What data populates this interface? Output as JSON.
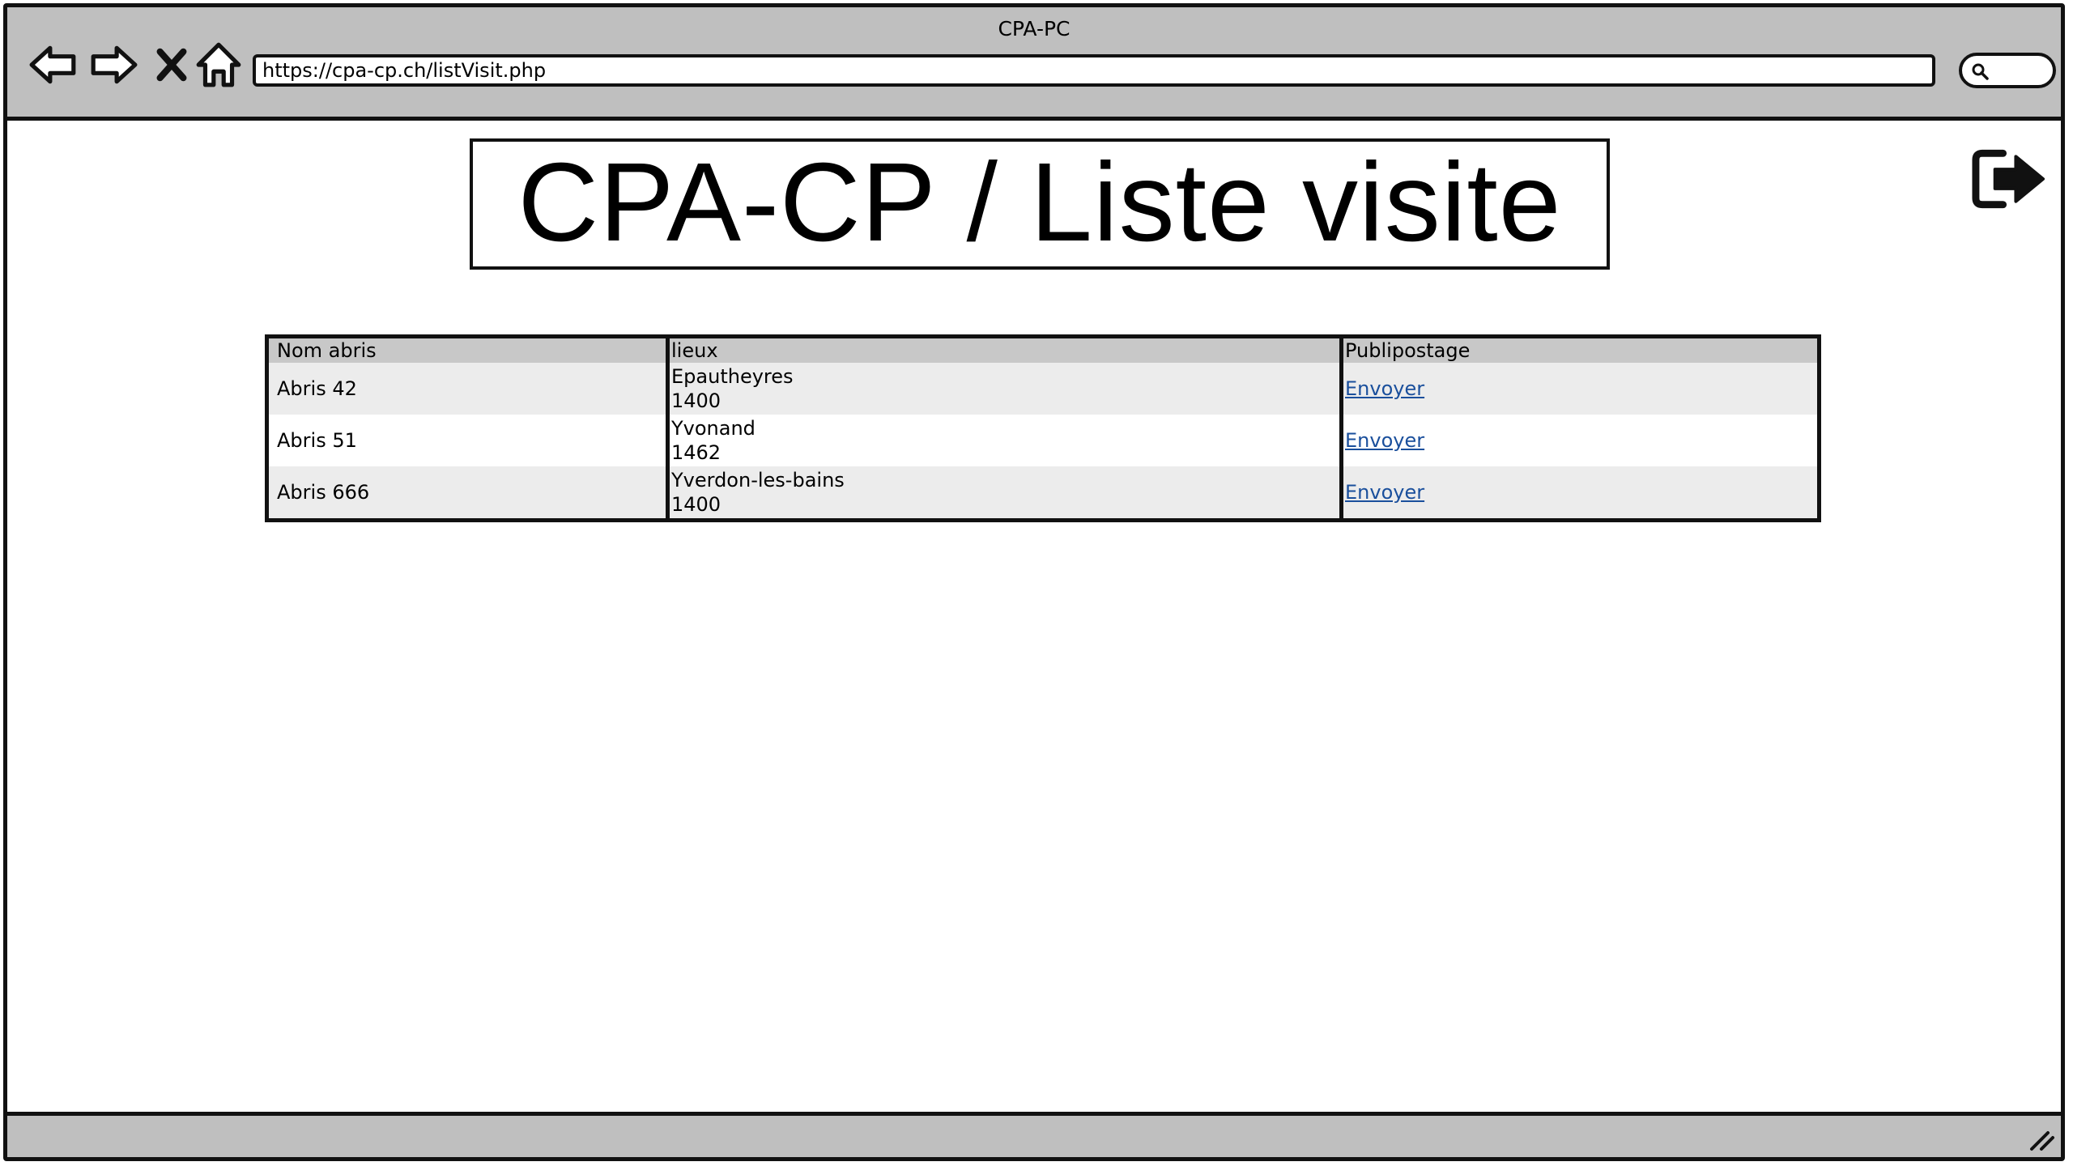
{
  "window": {
    "title": "CPA-PC"
  },
  "browser": {
    "url": "https://cpa-cp.ch/listVisit.php",
    "icons": [
      "back-arrow-icon",
      "forward-arrow-icon",
      "close-x-icon",
      "home-icon",
      "search-icon",
      "logout-icon",
      "resize-grip-icon"
    ]
  },
  "page": {
    "title": "CPA-CP / Liste visite"
  },
  "table": {
    "headers": [
      "Nom abris",
      "lieux",
      "Publipostage"
    ],
    "rows": [
      {
        "name": "Abris 42",
        "place": "Epautheyres",
        "postcode": "1400",
        "action": "Envoyer"
      },
      {
        "name": "Abris 51",
        "place": "Yvonand",
        "postcode": "1462",
        "action": "Envoyer"
      },
      {
        "name": "Abris 666",
        "place": "Yverdon-les-bains",
        "postcode": "1400",
        "action": "Envoyer"
      }
    ]
  },
  "colors": {
    "chrome": "#bfbfbf",
    "header_row": "#c8c8c8",
    "zebra": "#ececec",
    "link": "#1a4f9c"
  }
}
